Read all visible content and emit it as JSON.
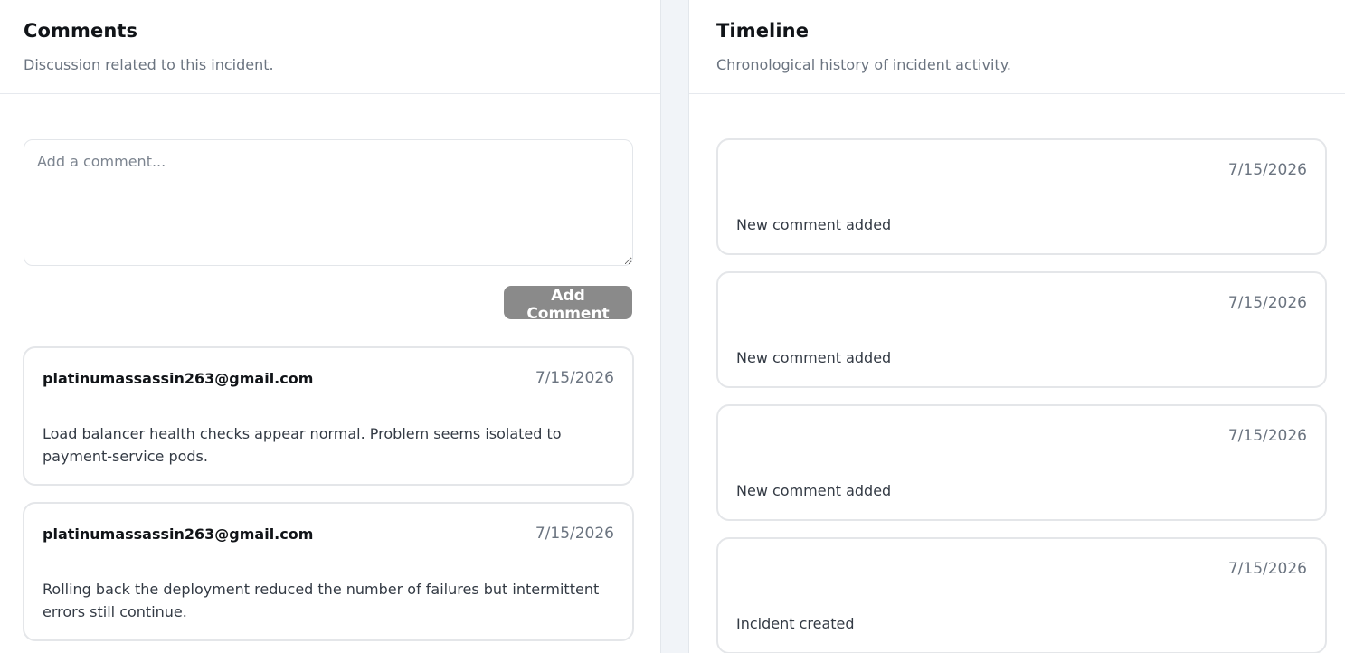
{
  "comments": {
    "title": "Comments",
    "subtitle": "Discussion related to this incident.",
    "input_placeholder": "Add a comment...",
    "add_button_label": "Add Comment",
    "items": [
      {
        "author": "platinumassassin263@gmail.com",
        "date": "7/15/2026",
        "body": "Load balancer health checks appear normal. Problem seems isolated to payment-service pods."
      },
      {
        "author": "platinumassassin263@gmail.com",
        "date": "7/15/2026",
        "body": "Rolling back the deployment reduced the number of failures but intermittent errors still continue."
      }
    ]
  },
  "timeline": {
    "title": "Timeline",
    "subtitle": "Chronological history of incident activity.",
    "items": [
      {
        "date": "7/15/2026",
        "text": "New comment added"
      },
      {
        "date": "7/15/2026",
        "text": "New comment added"
      },
      {
        "date": "7/15/2026",
        "text": "New comment added"
      },
      {
        "date": "7/15/2026",
        "text": "Incident created"
      }
    ]
  },
  "colors": {
    "button_disabled": "#8a8a8a",
    "divider_strip": "#f1f4f8",
    "muted_text": "#6b7480"
  }
}
